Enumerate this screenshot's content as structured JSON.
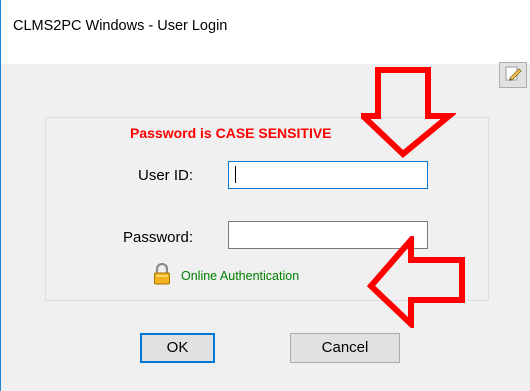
{
  "window": {
    "title": "CLMS2PC Windows - User Login"
  },
  "toolbar": {
    "edit_icon": "pencil-icon"
  },
  "form": {
    "warning": "Password is CASE SENSITIVE",
    "user_id_label": "User ID:",
    "user_id_value": "",
    "password_label": "Password:",
    "password_value": "",
    "auth_icon": "lock-icon",
    "auth_link": "Online Authentication"
  },
  "buttons": {
    "ok": "OK",
    "cancel": "Cancel"
  },
  "annotations": {
    "arrow_color": "#ff0000"
  },
  "colors": {
    "warning": "#ff0000",
    "link": "#008000",
    "focus_border": "#0078d7",
    "window_bg": "#f0f0f0"
  }
}
